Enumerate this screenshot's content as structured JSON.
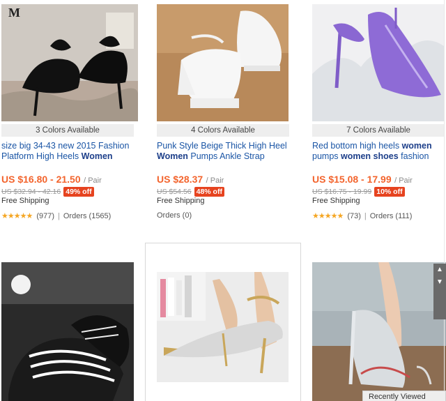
{
  "products": [
    {
      "colors": "3 Colors Available",
      "title_a": "size big 34-43 new 2015 Fashion Platform High Heels ",
      "title_hl": "Women",
      "title_b": "",
      "price": "US $16.80 - 21.50",
      "unit": "/ Pair",
      "orig": "US $32.94 - 42.16",
      "off": "49% off",
      "shipping": "Free Shipping",
      "stars": "★★★★★",
      "reviews": "(977)",
      "sep": "|",
      "orders": "Orders (1565)",
      "brand_mark": "M"
    },
    {
      "colors": "4 Colors Available",
      "title_a": "Punk Style Beige Thick High Heel ",
      "title_hl": "Women",
      "title_b": " Pumps Ankle Strap",
      "price": "US $28.37",
      "unit": "/ Pair",
      "orig": "US $54.56",
      "off": "48% off",
      "shipping": "Free Shipping",
      "orders": "Orders (0)"
    },
    {
      "colors": "7 Colors Available",
      "title_a": "Red bottom high heels ",
      "title_hl": "women",
      "title_b": " pumps ",
      "title_hl2": "women shoes",
      "title_c": " fashion",
      "price": "US $15.08 - 17.99",
      "unit": "/ Pair",
      "orig": "US $16.75 - 19.99",
      "off": "10% off",
      "shipping": "Free Shipping",
      "stars": "★★★★★",
      "reviews": "(73)",
      "sep": "|",
      "orders": "Orders (111)"
    }
  ],
  "recently_viewed": "Recently Viewed"
}
